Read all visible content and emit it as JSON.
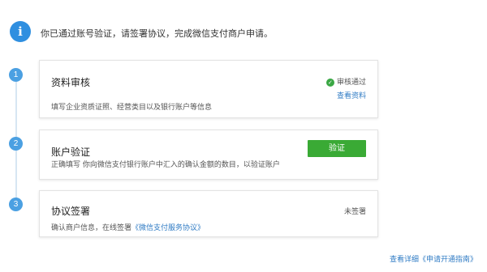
{
  "notice": {
    "icon": "info-icon",
    "icon_glyph": "i",
    "text": "你已通过账号验证，请签署协议，完成微信支付商户申请。"
  },
  "steps": [
    {
      "number": "1",
      "title": "资料审核",
      "description": "填写企业资质证照、经营类目以及银行账户等信息",
      "status": "审核通过",
      "status_icon": "check-circle-icon",
      "link": "查看资料"
    },
    {
      "number": "2",
      "title": "账户验证",
      "description": "正确填写 你向微信支付银行账户中汇入的确认金额的数目，以验证账户",
      "button": "验证"
    },
    {
      "number": "3",
      "title": "协议签署",
      "description_prefix": "确认商户信息，在线签署",
      "description_link": "《微信支付服务协议》",
      "status": "未签署"
    }
  ],
  "footer": {
    "link": "查看详细《申请开通指南》"
  },
  "colors": {
    "accent_blue": "#2f8fe0",
    "link_blue": "#2f7bc4",
    "success_green": "#3aaa35"
  }
}
